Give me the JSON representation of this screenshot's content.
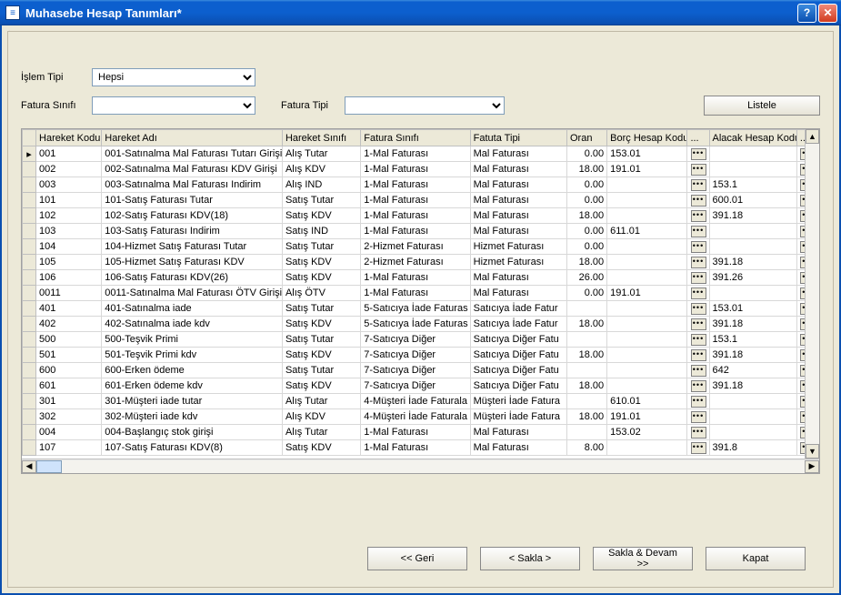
{
  "window": {
    "title": "Muhasebe Hesap Tanımları*"
  },
  "filters": {
    "islem_tipi_label": "İşlem Tipi",
    "islem_tipi_value": "Hepsi",
    "fatura_sinifi_label": "Fatura Sınıfı",
    "fatura_sinifi_value": "",
    "fatura_tipi_label": "Fatura Tipi",
    "fatura_tipi_value": "",
    "listele_label": "Listele"
  },
  "grid": {
    "headers": {
      "hareket_kodu": "Hareket Kodu",
      "hareket_adi": "Hareket Adı",
      "hareket_sinifi": "Hareket Sınıfı",
      "fatura_sinifi": "Fatura Sınıfı",
      "fatura_tipi": "Fatuta Tipi",
      "oran": "Oran",
      "borc_hesap_kodu": "Borç Hesap Kodu",
      "alacak_hesap_kodu": "Alacak Hesap Kodu"
    },
    "rows": [
      {
        "mark": "▸",
        "kod": "001",
        "adi": "001-Satınalma Mal Faturası Tutarı Girişi",
        "sinif": "Alış Tutar",
        "fsinif": "1-Mal Faturası",
        "ftipi": "Mal Faturası",
        "oran": "0.00",
        "borc": "153.01",
        "alacak": ""
      },
      {
        "mark": "",
        "kod": "002",
        "adi": "002-Satınalma Mal Faturası KDV Girişi",
        "sinif": "Alış KDV",
        "fsinif": "1-Mal Faturası",
        "ftipi": "Mal Faturası",
        "oran": "18.00",
        "borc": "191.01",
        "alacak": ""
      },
      {
        "mark": "",
        "kod": "003",
        "adi": "003-Satınalma Mal Faturası Indirim",
        "sinif": "Alış IND",
        "fsinif": "1-Mal Faturası",
        "ftipi": "Mal Faturası",
        "oran": "0.00",
        "borc": "",
        "alacak": "153.1"
      },
      {
        "mark": "",
        "kod": "101",
        "adi": "101-Satış Faturası Tutar",
        "sinif": "Satış Tutar",
        "fsinif": "1-Mal Faturası",
        "ftipi": "Mal Faturası",
        "oran": "0.00",
        "borc": "",
        "alacak": "600.01"
      },
      {
        "mark": "",
        "kod": "102",
        "adi": "102-Satış Faturası KDV(18)",
        "sinif": "Satış KDV",
        "fsinif": "1-Mal Faturası",
        "ftipi": "Mal Faturası",
        "oran": "18.00",
        "borc": "",
        "alacak": "391.18"
      },
      {
        "mark": "",
        "kod": "103",
        "adi": "103-Satış Faturası Indirim",
        "sinif": "Satış IND",
        "fsinif": "1-Mal Faturası",
        "ftipi": "Mal Faturası",
        "oran": "0.00",
        "borc": "611.01",
        "alacak": ""
      },
      {
        "mark": "",
        "kod": "104",
        "adi": "104-Hizmet Satış Faturası Tutar",
        "sinif": "Satış Tutar",
        "fsinif": "2-Hizmet Faturası",
        "ftipi": "Hizmet Faturası",
        "oran": "0.00",
        "borc": "",
        "alacak": ""
      },
      {
        "mark": "",
        "kod": "105",
        "adi": "105-Hizmet Satış Faturası KDV",
        "sinif": "Satış KDV",
        "fsinif": "2-Hizmet Faturası",
        "ftipi": "Hizmet Faturası",
        "oran": "18.00",
        "borc": "",
        "alacak": "391.18"
      },
      {
        "mark": "",
        "kod": "106",
        "adi": "106-Satış Faturası KDV(26)",
        "sinif": "Satış KDV",
        "fsinif": "1-Mal Faturası",
        "ftipi": "Mal Faturası",
        "oran": "26.00",
        "borc": "",
        "alacak": "391.26"
      },
      {
        "mark": "",
        "kod": "0011",
        "adi": "0011-Satınalma Mal Faturası ÖTV Girişi",
        "sinif": "Alış ÖTV",
        "fsinif": "1-Mal Faturası",
        "ftipi": "Mal Faturası",
        "oran": "0.00",
        "borc": "191.01",
        "alacak": ""
      },
      {
        "mark": "",
        "kod": "401",
        "adi": "401-Satınalma iade",
        "sinif": "Satış Tutar",
        "fsinif": "5-Satıcıya İade Faturas",
        "ftipi": "Satıcıya İade Fatur",
        "oran": "",
        "borc": "",
        "alacak": "153.01"
      },
      {
        "mark": "",
        "kod": "402",
        "adi": "402-Satınalma iade kdv",
        "sinif": "Satış KDV",
        "fsinif": "5-Satıcıya İade Faturas",
        "ftipi": "Satıcıya İade Fatur",
        "oran": "18.00",
        "borc": "",
        "alacak": "391.18"
      },
      {
        "mark": "",
        "kod": "500",
        "adi": "500-Teşvik Primi",
        "sinif": "Satış Tutar",
        "fsinif": "7-Satıcıya Diğer",
        "ftipi": "Satıcıya Diğer Fatu",
        "oran": "",
        "borc": "",
        "alacak": "153.1"
      },
      {
        "mark": "",
        "kod": "501",
        "adi": "501-Teşvik Primi kdv",
        "sinif": "Satış KDV",
        "fsinif": "7-Satıcıya Diğer",
        "ftipi": "Satıcıya Diğer Fatu",
        "oran": "18.00",
        "borc": "",
        "alacak": "391.18"
      },
      {
        "mark": "",
        "kod": "600",
        "adi": "600-Erken ödeme",
        "sinif": "Satış Tutar",
        "fsinif": "7-Satıcıya Diğer",
        "ftipi": "Satıcıya Diğer Fatu",
        "oran": "",
        "borc": "",
        "alacak": "642"
      },
      {
        "mark": "",
        "kod": "601",
        "adi": "601-Erken ödeme kdv",
        "sinif": "Satış KDV",
        "fsinif": "7-Satıcıya Diğer",
        "ftipi": "Satıcıya Diğer Fatu",
        "oran": "18.00",
        "borc": "",
        "alacak": "391.18"
      },
      {
        "mark": "",
        "kod": "301",
        "adi": "301-Müşteri iade tutar",
        "sinif": "Alış Tutar",
        "fsinif": "4-Müşteri İade Faturala",
        "ftipi": "Müşteri İade Fatura",
        "oran": "",
        "borc": "610.01",
        "alacak": ""
      },
      {
        "mark": "",
        "kod": "302",
        "adi": "302-Müşteri iade kdv",
        "sinif": "Alış KDV",
        "fsinif": "4-Müşteri İade Faturala",
        "ftipi": "Müşteri İade Fatura",
        "oran": "18.00",
        "borc": "191.01",
        "alacak": ""
      },
      {
        "mark": "",
        "kod": "004",
        "adi": "004-Başlangıç stok girişi",
        "sinif": "Alış Tutar",
        "fsinif": "1-Mal Faturası",
        "ftipi": "Mal Faturası",
        "oran": "",
        "borc": "153.02",
        "alacak": ""
      },
      {
        "mark": "",
        "kod": "107",
        "adi": "107-Satış Faturası KDV(8)",
        "sinif": "Satış KDV",
        "fsinif": "1-Mal Faturası",
        "ftipi": "Mal Faturası",
        "oran": "8.00",
        "borc": "",
        "alacak": "391.8"
      }
    ]
  },
  "footer": {
    "geri": "<< Geri",
    "sakla": "< Sakla >",
    "sakla_devam": "Sakla & Devam >>",
    "kapat": "Kapat"
  }
}
